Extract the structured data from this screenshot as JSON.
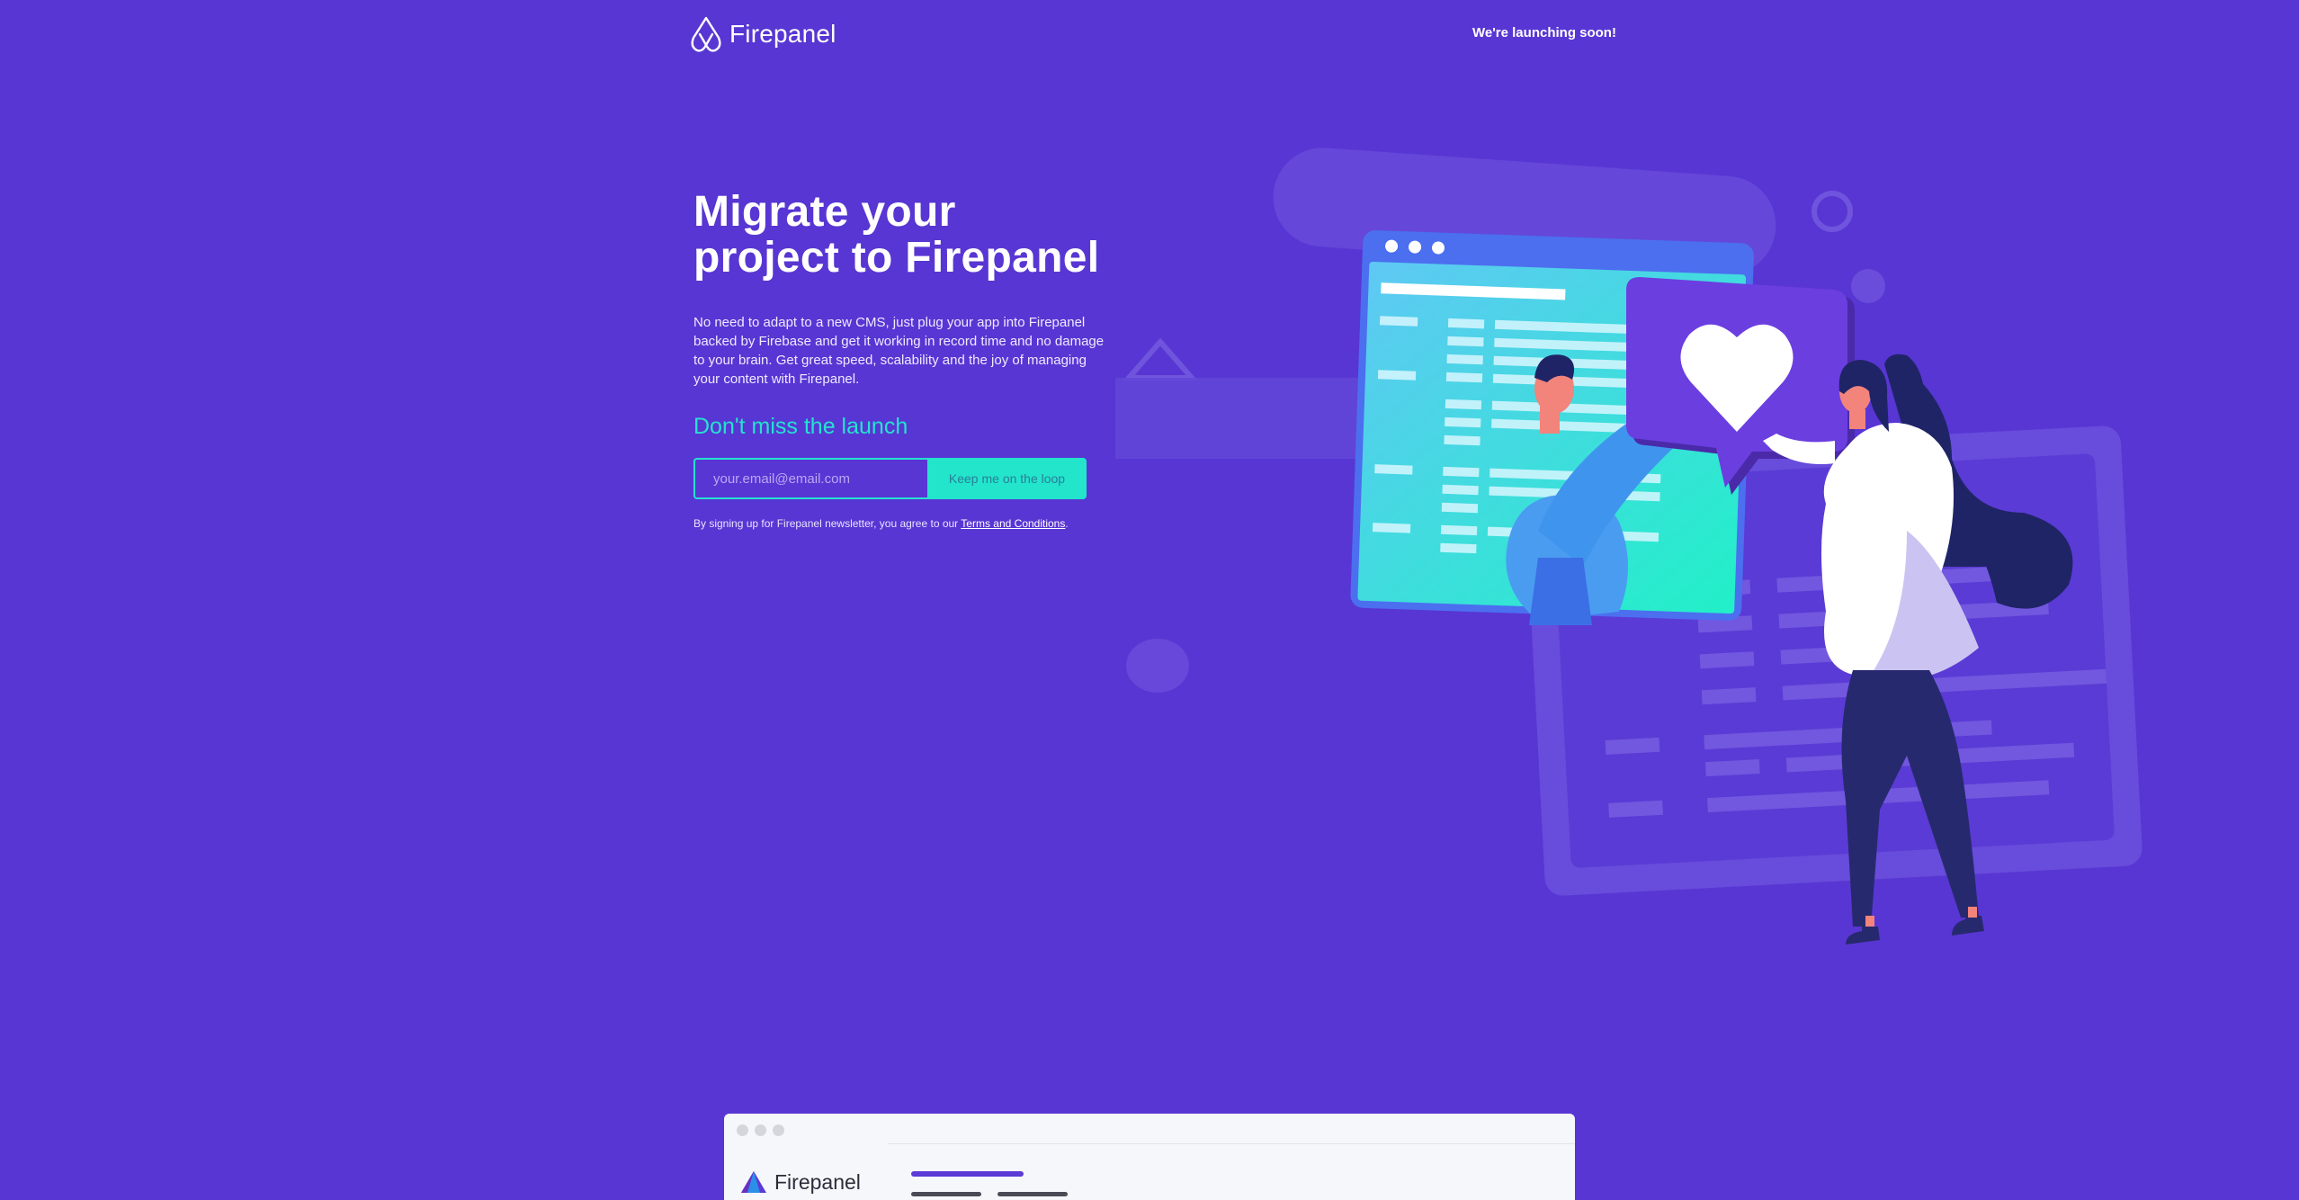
{
  "header": {
    "brand": "Firepanel",
    "logo_icon": "flame-outline-icon",
    "launch_note": "We're launching soon!"
  },
  "hero": {
    "title_line1": "Migrate your",
    "title_line2": "project to Firepanel",
    "description": "No need to adapt to a new CMS, just plug your app into Firepanel backed by Firebase and get it working in record time and no damage to your brain. Get great speed, scalability and the joy of managing your content with Firepanel.",
    "cta_heading": "Don't miss the launch",
    "email_placeholder": "your.email@email.com",
    "button_label": "Keep me on the loop",
    "legal_text": "By signing up for Firepanel newsletter, you agree to our",
    "legal_link": "Terms and Conditions",
    "legal_end": "."
  },
  "illustration": {
    "description_icon": "people-with-heart-illustration",
    "heart_icon": "heart-icon"
  },
  "preview": {
    "brand": "Firepanel",
    "logo_icon": "firepanel-triangle-logo-icon"
  },
  "colors": {
    "background": "#5836d3",
    "accent": "#22e5cc",
    "text": "#ffffff"
  }
}
